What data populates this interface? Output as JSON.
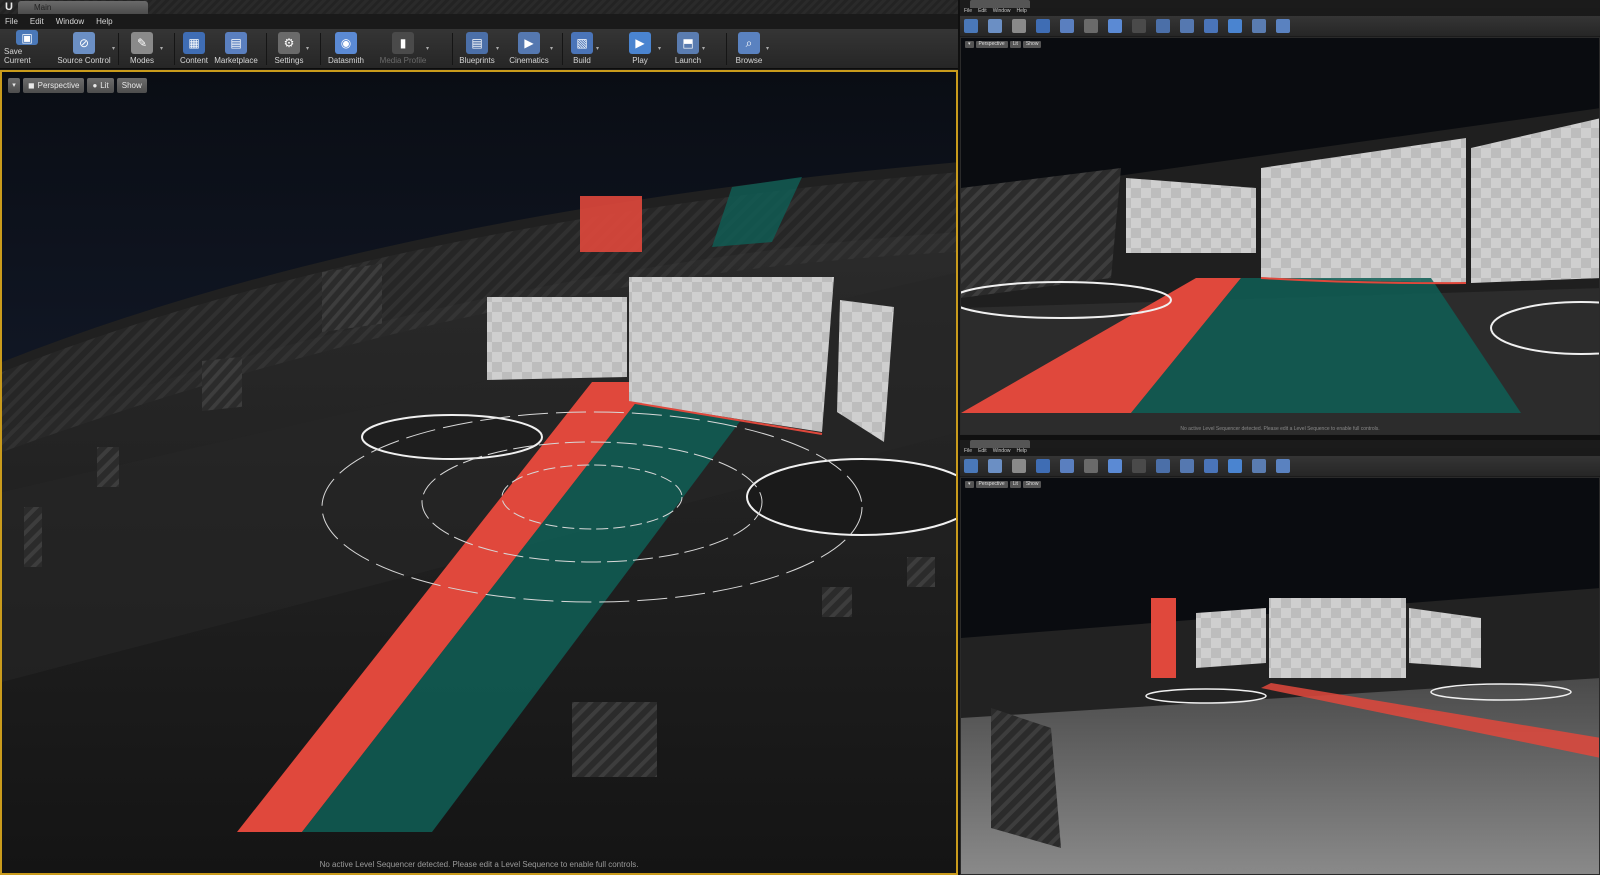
{
  "app": {
    "tab_title": "Main",
    "logo": "U"
  },
  "menu": [
    "File",
    "Edit",
    "Window",
    "Help"
  ],
  "toolbar": [
    {
      "label": "Save Current",
      "icon": "save-icon",
      "color": "#4a78b8",
      "dropdown": false,
      "disabled": false
    },
    {
      "label": "Source Control",
      "icon": "source-control-icon",
      "color": "#6b8fc4",
      "dropdown": true,
      "disabled": false
    },
    {
      "label": "Modes",
      "icon": "modes-icon",
      "color": "#8a8a8a",
      "dropdown": true,
      "disabled": false
    },
    {
      "label": "Content",
      "icon": "content-icon",
      "color": "#3f6db4",
      "dropdown": false,
      "disabled": false
    },
    {
      "label": "Marketplace",
      "icon": "marketplace-icon",
      "color": "#5a7fbf",
      "dropdown": false,
      "disabled": false
    },
    {
      "label": "Settings",
      "icon": "settings-icon",
      "color": "#6a6a6a",
      "dropdown": true,
      "disabled": false
    },
    {
      "label": "Datasmith",
      "icon": "datasmith-icon",
      "color": "#5b8ad4",
      "dropdown": false,
      "disabled": false
    },
    {
      "label": "Media Profile",
      "icon": "media-profile-icon",
      "color": "#4a4a4a",
      "dropdown": true,
      "disabled": true
    },
    {
      "label": "Blueprints",
      "icon": "blueprints-icon",
      "color": "#4b6fa8",
      "dropdown": true,
      "disabled": false
    },
    {
      "label": "Cinematics",
      "icon": "cinematics-icon",
      "color": "#5578b0",
      "dropdown": true,
      "disabled": false
    },
    {
      "label": "Build",
      "icon": "build-icon",
      "color": "#4a74b8",
      "dropdown": true,
      "disabled": false
    },
    {
      "label": "Play",
      "icon": "play-icon",
      "color": "#4a84d0",
      "dropdown": true,
      "disabled": false
    },
    {
      "label": "Launch",
      "icon": "launch-icon",
      "color": "#5a7cb0",
      "dropdown": true,
      "disabled": false
    },
    {
      "label": "Browse",
      "icon": "browse-icon",
      "color": "#5a82c0",
      "dropdown": true,
      "disabled": false
    }
  ],
  "viewport": {
    "perspective_label": "Perspective",
    "lit_label": "Lit",
    "show_label": "Show",
    "status": "No active Level Sequencer detected. Please edit a Level Sequence to enable full controls."
  },
  "colors": {
    "accent_border": "#c99b1c",
    "stage_red": "#e0483c",
    "stage_teal": "#0f5f56"
  }
}
